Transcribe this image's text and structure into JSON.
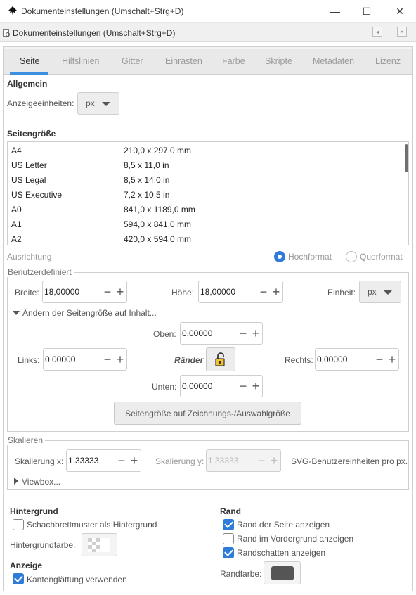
{
  "window": {
    "title": "Dokumenteinstellungen (Umschalt+Strg+D)",
    "minimize": "—",
    "maximize": "☐",
    "close": "✕"
  },
  "dock": {
    "title": "Dokumenteinstellungen (Umschalt+Strg+D)",
    "pin_icon": "◂",
    "close_icon": "✕"
  },
  "tabs": [
    "Seite",
    "Hilfslinien",
    "Gitter",
    "Einrasten",
    "Farbe",
    "Skripte",
    "Metadaten",
    "Lizenz"
  ],
  "active_tab": "Seite",
  "general": {
    "heading": "Allgemein",
    "display_units_label": "Anzeigeeinheiten:",
    "display_units_value": "px"
  },
  "page_size": {
    "heading": "Seitengröße",
    "formats": [
      {
        "name": "A4",
        "size": "210,0 x 297,0 mm"
      },
      {
        "name": "US Letter",
        "size": "8,5 x 11,0 in"
      },
      {
        "name": "US Legal",
        "size": "8,5 x 14,0 in"
      },
      {
        "name": "US Executive",
        "size": "7,2 x 10,5 in"
      },
      {
        "name": "A0",
        "size": "841,0 x 1189,0 mm"
      },
      {
        "name": "A1",
        "size": "594,0 x 841,0 mm"
      },
      {
        "name": "A2",
        "size": "420,0 x 594,0 mm"
      }
    ]
  },
  "orientation": {
    "label": "Ausrichtung",
    "portrait": "Hochformat",
    "landscape": "Querformat",
    "selected": "Hochformat"
  },
  "custom": {
    "title": "Benutzerdefiniert",
    "width_label": "Breite:",
    "width_value": "18,00000",
    "height_label": "Höhe:",
    "height_value": "18,00000",
    "unit_label": "Einheit:",
    "unit_value": "px",
    "resize_expander": "Ändern der Seitengröße auf Inhalt...",
    "top_label": "Oben:",
    "top_value": "0,00000",
    "left_label": "Links:",
    "left_value": "0,00000",
    "margins_label": "Ränder",
    "right_label": "Rechts:",
    "right_value": "0,00000",
    "bottom_label": "Unten:",
    "bottom_value": "0,00000",
    "resize_button": "Seitengröße auf Zeichnungs-/Auswahlgröße"
  },
  "scale": {
    "title": "Skalieren",
    "scale_x_label": "Skalierung x:",
    "scale_x_value": "1,33333",
    "scale_y_label": "Skalierung y:",
    "scale_y_value": "1,33333",
    "units_note": "SVG-Benutzereinheiten pro px.",
    "viewbox_expander": "Viewbox..."
  },
  "background": {
    "heading": "Hintergrund",
    "checkerboard_label": "Schachbrettmuster als Hintergrund",
    "checkerboard_checked": false,
    "color_label": "Hintergrundfarbe:"
  },
  "display": {
    "heading": "Anzeige",
    "antialias_label": "Kantenglättung verwenden",
    "antialias_checked": true
  },
  "border": {
    "heading": "Rand",
    "show_border_label": "Rand der Seite anzeigen",
    "show_border_checked": true,
    "border_on_top_label": "Rand im Vordergrund anzeigen",
    "border_on_top_checked": false,
    "shadow_label": "Randschatten anzeigen",
    "shadow_checked": true,
    "color_label": "Randfarbe:",
    "color": "#555555"
  },
  "colors": {
    "accent": "#2f7bd8",
    "tab_underline": "#3d8fe0",
    "radio_selected": "#2f7bd8"
  }
}
